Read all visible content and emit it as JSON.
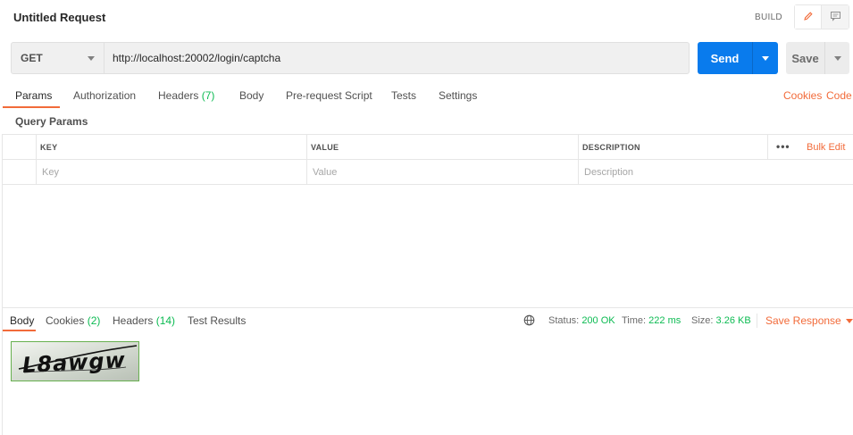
{
  "header": {
    "title": "Untitled Request",
    "build_label": "BUILD"
  },
  "request": {
    "method": "GET",
    "url": "http://localhost:20002/login/captcha",
    "send_label": "Send",
    "save_label": "Save"
  },
  "request_tabs": {
    "params": "Params",
    "authorization": "Authorization",
    "headers": "Headers",
    "headers_count": "(7)",
    "body": "Body",
    "prerequest": "Pre-request Script",
    "tests": "Tests",
    "settings": "Settings",
    "cookies": "Cookies",
    "code": "Code"
  },
  "query_params": {
    "label": "Query Params",
    "columns": {
      "key": "KEY",
      "value": "VALUE",
      "description": "DESCRIPTION"
    },
    "bulk_edit": "Bulk Edit",
    "more": "•••",
    "placeholders": {
      "key": "Key",
      "value": "Value",
      "description": "Description"
    }
  },
  "response": {
    "tabs": {
      "body": "Body",
      "cookies": "Cookies",
      "cookies_count": "(2)",
      "headers": "Headers",
      "headers_count": "(14)",
      "test_results": "Test Results"
    },
    "status_label": "Status:",
    "status_value": "200 OK",
    "time_label": "Time:",
    "time_value": "222 ms",
    "size_label": "Size:",
    "size_value": "3.26 KB",
    "save_response": "Save Response",
    "captcha_text": "L8awgw"
  },
  "colors": {
    "accent": "#f26b3a",
    "primary": "#097bed",
    "success": "#0cbb52"
  }
}
